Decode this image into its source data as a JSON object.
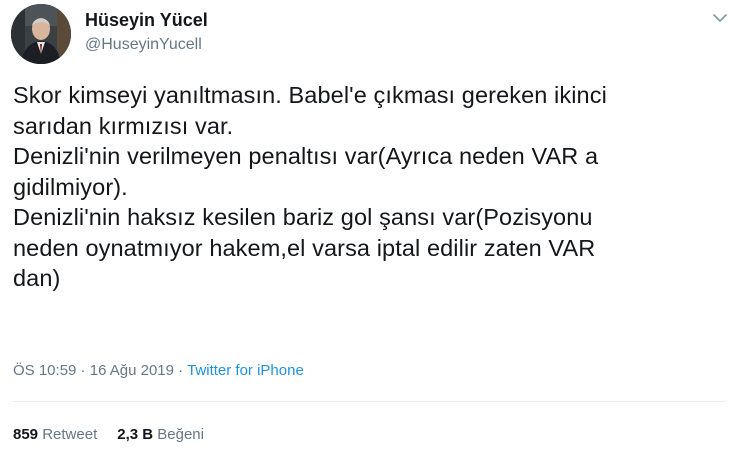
{
  "user": {
    "display_name": "Hüseyin Yücel",
    "handle": "@HuseyinYucell"
  },
  "icons": {
    "avatar": "profile-photo",
    "menu": "chevron-down-icon"
  },
  "tweet": {
    "text": "Skor kimseyi yanıltmasın. Babel'e çıkması gereken ikinci\nsarıdan kırmızısı var.\nDenizli'nin verilmeyen penaltısı var(Ayrıca neden VAR a\ngidilmiyor).\nDenizli'nin haksız kesilen bariz gol şansı var(Pozisyonu\nneden oynatmıyor hakem,el varsa iptal edilir zaten VAR\ndan)"
  },
  "meta": {
    "time": "ÖS 10:59",
    "separator1": " · ",
    "date": "16 Ağu 2019",
    "separator2": " · ",
    "source": "Twitter for iPhone"
  },
  "stats": {
    "retweets_count": "859",
    "retweets_label": "Retweet",
    "likes_count": "2,3 B",
    "likes_label": "Beğeni"
  },
  "colors": {
    "text": "#14171a",
    "secondary": "#657786",
    "link": "#1b95e0",
    "divider": "#e6ecf0"
  }
}
